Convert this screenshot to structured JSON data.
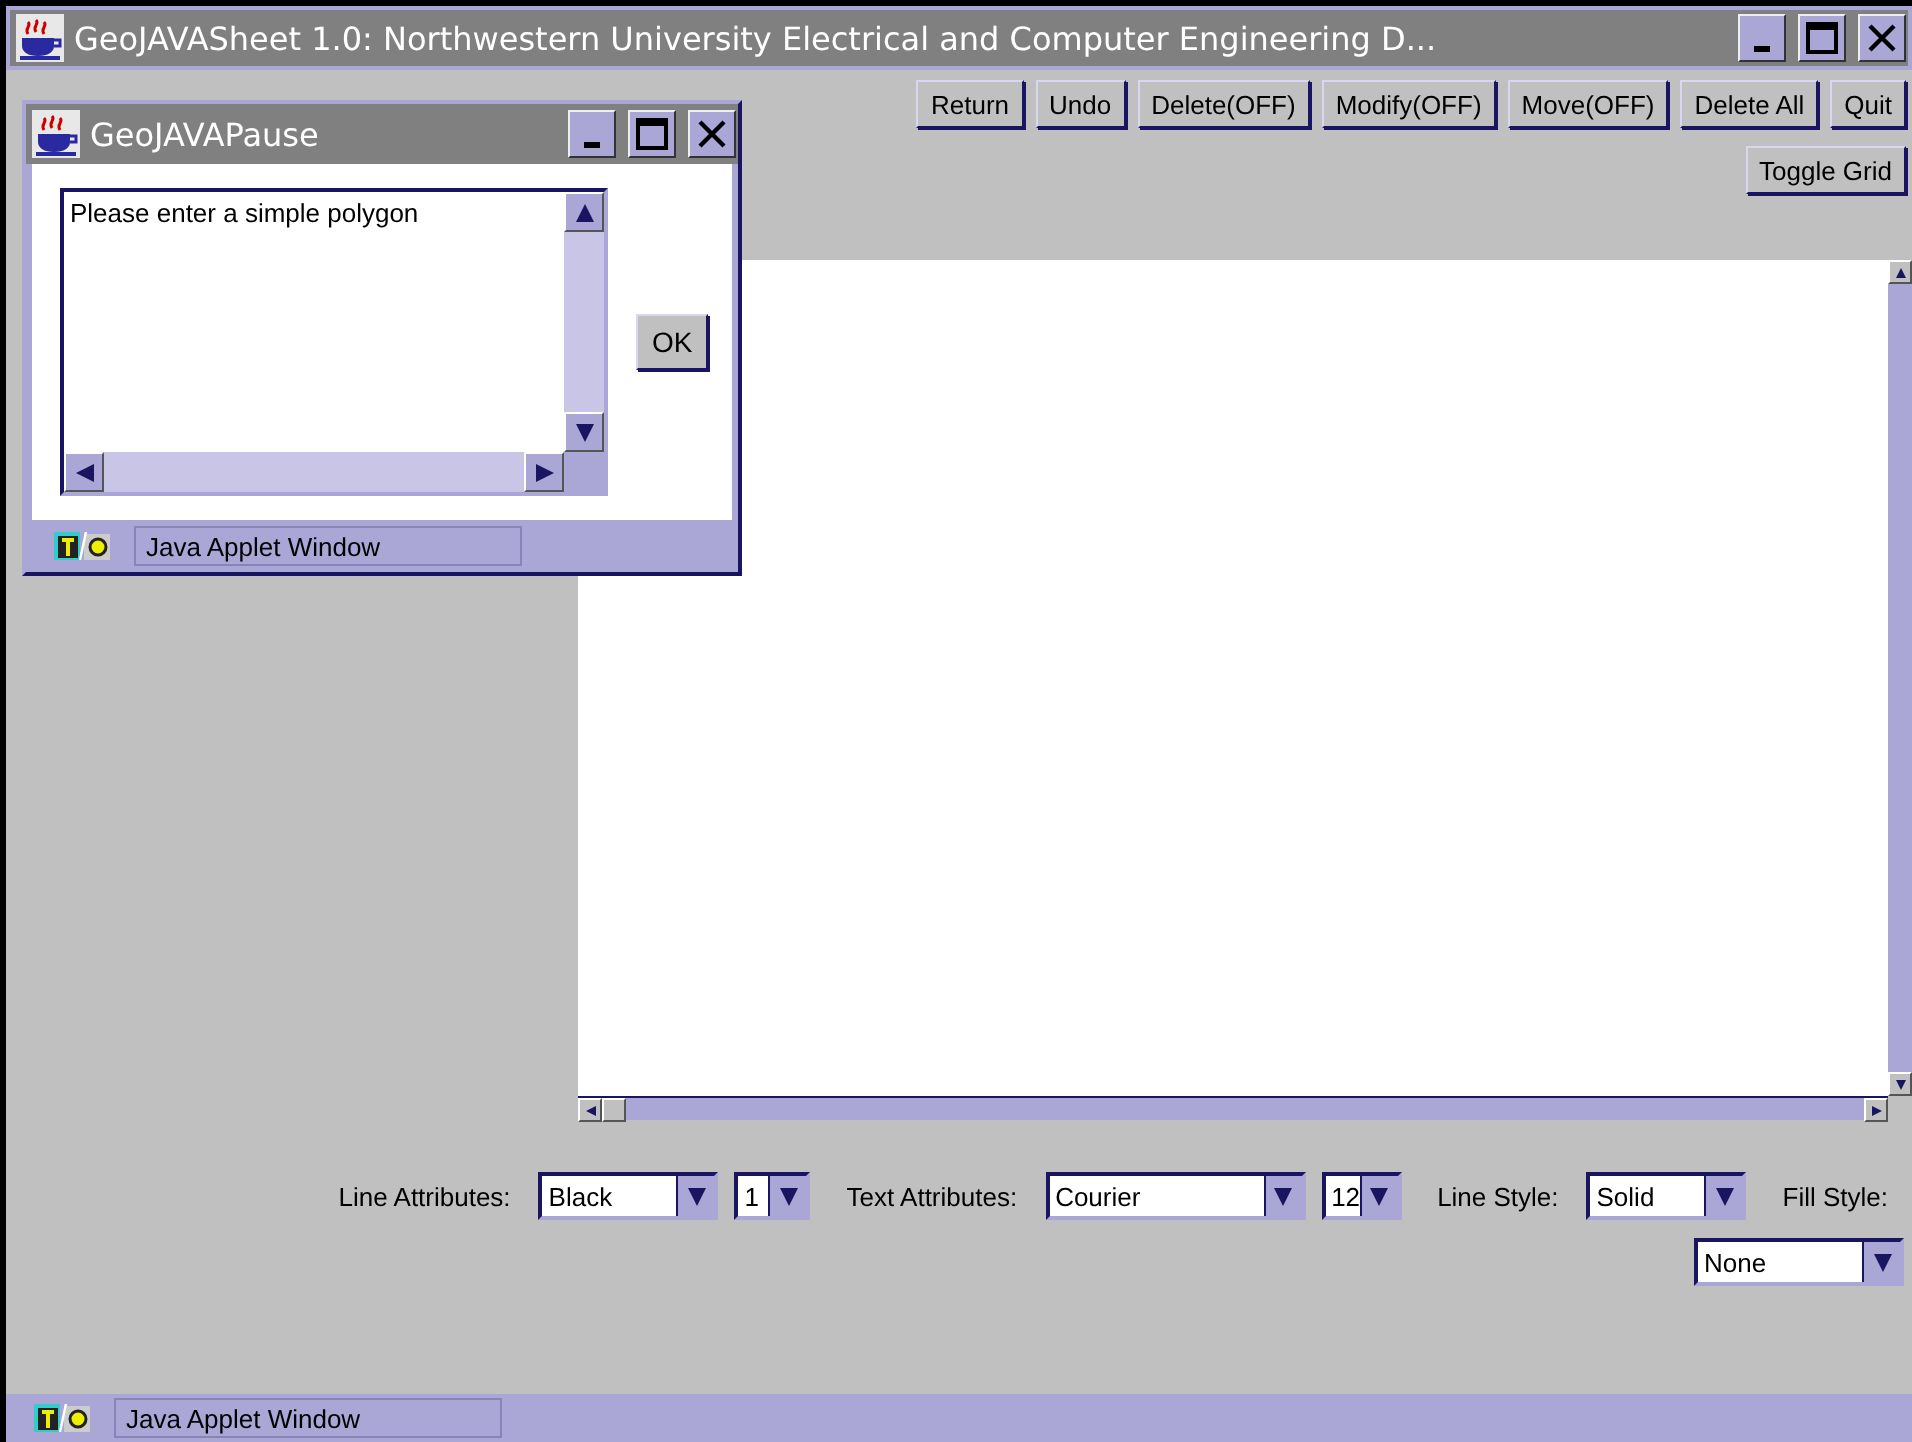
{
  "window": {
    "title": "GeoJAVASheet 1.0: Northwestern University Electrical and Computer Engineering D..."
  },
  "toolbar": [
    {
      "label": "Return"
    },
    {
      "label": "Undo"
    },
    {
      "label": "Delete(OFF)"
    },
    {
      "label": "Modify(OFF)"
    },
    {
      "label": "Move(OFF)"
    },
    {
      "label": "Delete All"
    },
    {
      "label": "Quit"
    }
  ],
  "toggle_grid": {
    "label": "Toggle Grid"
  },
  "attributes": [
    {
      "kind": "label",
      "text": "Line Attributes:"
    },
    {
      "kind": "select",
      "value": "Black"
    },
    {
      "kind": "select",
      "value": "1"
    },
    {
      "kind": "label",
      "text": "Text Attributes:"
    },
    {
      "kind": "select",
      "value": "Courier"
    },
    {
      "kind": "select",
      "value": "12"
    },
    {
      "kind": "label",
      "text": "Line Style:"
    },
    {
      "kind": "select",
      "value": "Solid"
    },
    {
      "kind": "label",
      "text": "Fill Style:"
    }
  ],
  "fill_select": {
    "value": "None"
  },
  "status_bar": "Java Applet Window",
  "dialog": {
    "title": "GeoJAVAPause",
    "message": "Please enter a simple polygon",
    "ok": "OK",
    "status_bar": "Java Applet Window"
  }
}
